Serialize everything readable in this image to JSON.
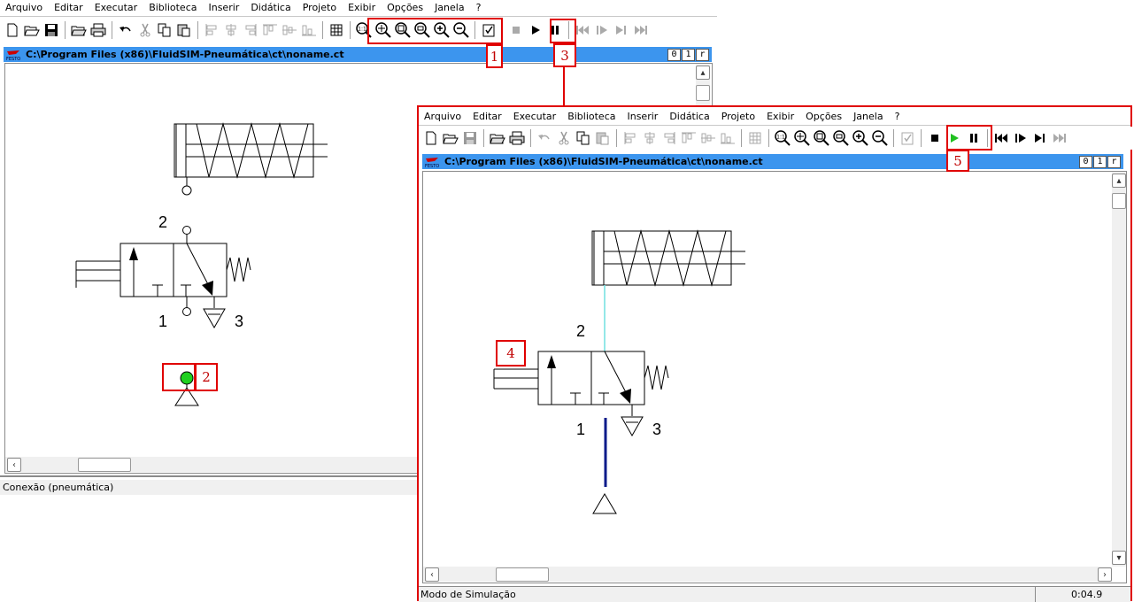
{
  "menus": [
    "Arquivo",
    "Editar",
    "Executar",
    "Biblioteca",
    "Inserir",
    "Didática",
    "Projeto",
    "Exibir",
    "Opções",
    "Janela",
    "?"
  ],
  "document": {
    "path": "C:\\Program Files (x86)\\FluidSIM-Pneumática\\ct\\noname.ct",
    "title_buttons": [
      "0",
      "1",
      "r"
    ]
  },
  "left_window": {
    "status_text": "Conexão (pneumática)"
  },
  "right_window": {
    "status_text": "Modo de Simulação",
    "status_time": "0:04.9"
  },
  "circuit": {
    "port_2": "2",
    "port_1": "1",
    "port_3": "3"
  },
  "annotations": {
    "zoom_tools": "1",
    "air_source": "2",
    "play_button": "3",
    "valve_actuator": "4",
    "sim_controls": "5"
  },
  "colors": {
    "titlebar": "#3c95ee",
    "highlight": "#e00000",
    "air_active": "#20d020",
    "line_pressurized": "#0a1a8a",
    "line_flow": "#6fe0e0"
  },
  "icons": {
    "toolbar": [
      "new-icon",
      "open-icon",
      "save-icon",
      "open-folder-icon",
      "print-icon",
      "undo-icon",
      "cut-icon",
      "copy-icon",
      "paste-icon",
      "align-left-icon",
      "align-center-icon",
      "align-right-icon",
      "distribute-top-icon",
      "distribute-middle-icon",
      "distribute-bottom-icon",
      "grid-icon",
      "zoom-100-icon",
      "zoom-fit-icon",
      "zoom-window-icon",
      "zoom-all-icon",
      "zoom-in-icon",
      "zoom-out-icon",
      "check-icon",
      "stop-icon",
      "play-icon",
      "pause-icon",
      "skip-start-icon",
      "step-icon",
      "step-end-icon",
      "skip-end-icon"
    ]
  }
}
